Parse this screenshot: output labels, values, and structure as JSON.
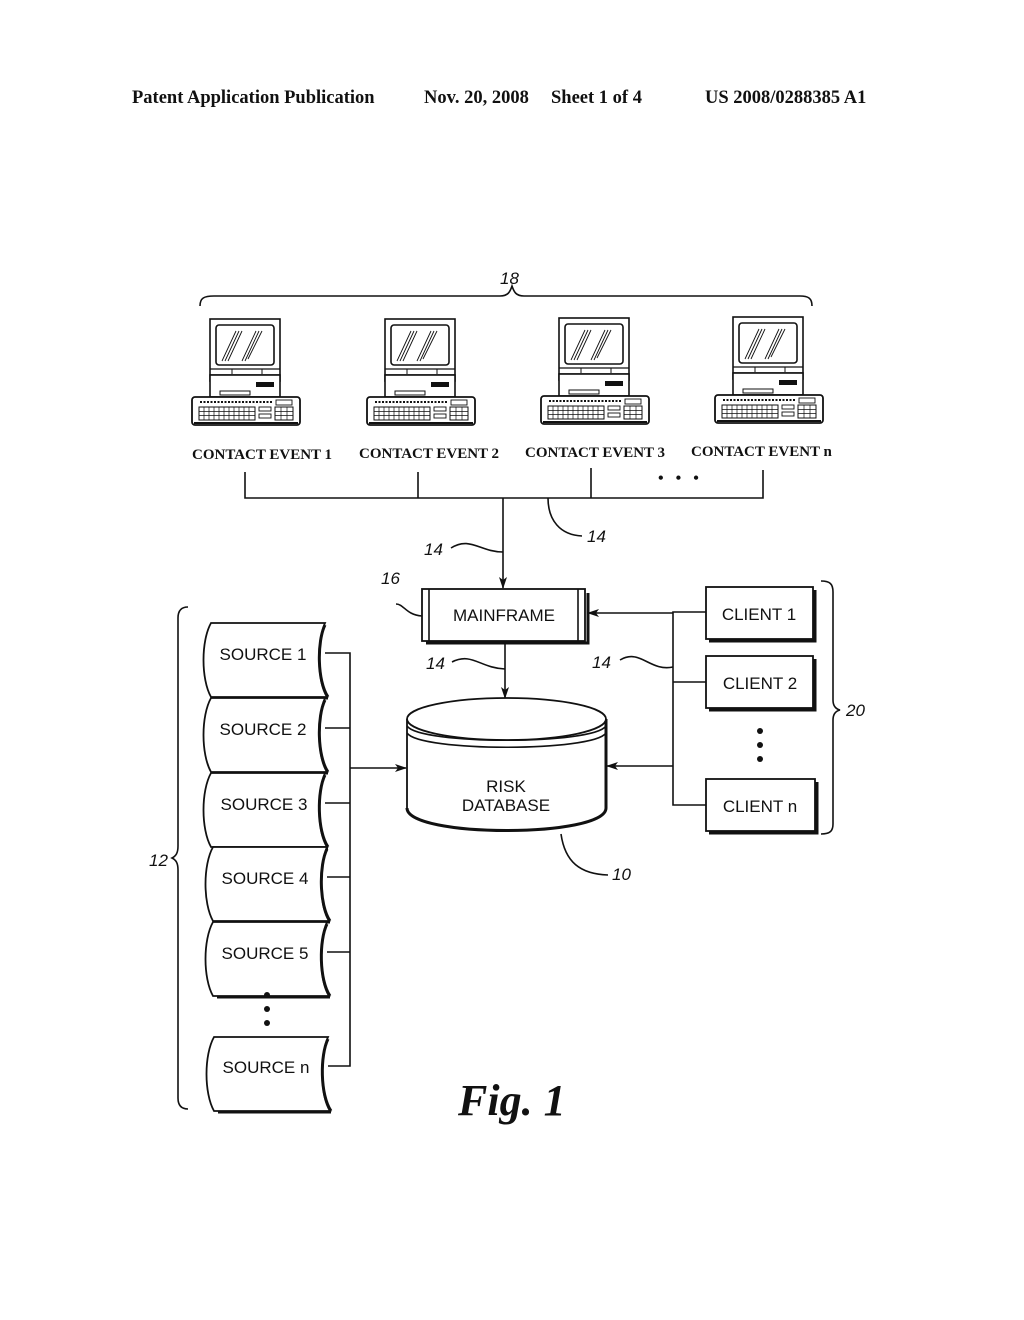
{
  "header": {
    "publication_type": "Patent Application Publication",
    "date": "Nov. 20, 2008",
    "sheet": "Sheet 1 of 4",
    "publication_number": "US 2008/0288385 A1"
  },
  "figure": {
    "caption": "Fig. 1",
    "contact_events": {
      "ref": "18",
      "items": [
        {
          "label": "CONTACT EVENT 1",
          "icon": "computer-workstation-icon"
        },
        {
          "label": "CONTACT EVENT 2",
          "icon": "computer-workstation-icon"
        },
        {
          "label": "CONTACT EVENT 3",
          "icon": "computer-workstation-icon"
        },
        {
          "label": "CONTACT EVENT n",
          "icon": "computer-workstation-icon"
        }
      ],
      "ellipsis": "• • •"
    },
    "network_refs": [
      "14",
      "14",
      "14",
      "14"
    ],
    "mainframe": {
      "label": "MAINFRAME",
      "ref": "16"
    },
    "database": {
      "label_line1": "RISK",
      "label_line2": "DATABASE",
      "ref": "10"
    },
    "sources": {
      "ref": "12",
      "items": [
        "SOURCE 1",
        "SOURCE 2",
        "SOURCE 3",
        "SOURCE 4",
        "SOURCE 5",
        "SOURCE n"
      ]
    },
    "clients": {
      "ref": "20",
      "items": [
        "CLIENT 1",
        "CLIENT 2",
        "CLIENT n"
      ]
    }
  }
}
